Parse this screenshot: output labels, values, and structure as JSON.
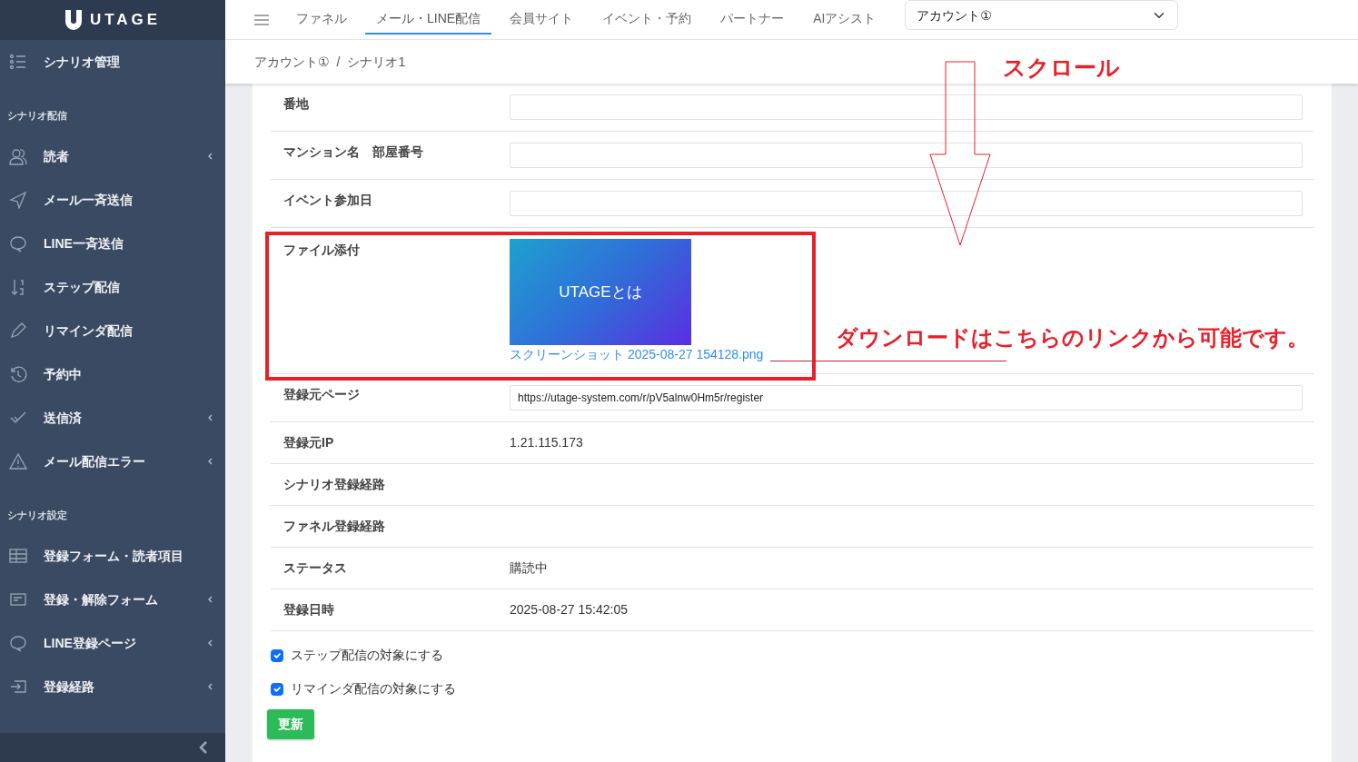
{
  "brand": {
    "name": "UTAGE"
  },
  "sidebar": {
    "items": [
      {
        "kind": "item",
        "label": "シナリオ管理",
        "submenu": false
      },
      {
        "kind": "heading",
        "label": "シナリオ配信"
      },
      {
        "kind": "item",
        "label": "読者",
        "submenu": true
      },
      {
        "kind": "item",
        "label": "メール一斉送信",
        "submenu": false
      },
      {
        "kind": "item",
        "label": "LINE一斉送信",
        "submenu": false
      },
      {
        "kind": "item",
        "label": "ステップ配信",
        "submenu": false
      },
      {
        "kind": "item",
        "label": "リマインダ配信",
        "submenu": false
      },
      {
        "kind": "item",
        "label": "予約中",
        "submenu": false
      },
      {
        "kind": "item",
        "label": "送信済",
        "submenu": true
      },
      {
        "kind": "item",
        "label": "メール配信エラー",
        "submenu": true
      },
      {
        "kind": "heading",
        "label": "シナリオ設定"
      },
      {
        "kind": "item",
        "label": "登録フォーム・読者項目",
        "submenu": false
      },
      {
        "kind": "item",
        "label": "登録・解除フォーム",
        "submenu": true
      },
      {
        "kind": "item",
        "label": "LINE登録ページ",
        "submenu": true
      },
      {
        "kind": "item",
        "label": "登録経路",
        "submenu": true
      }
    ]
  },
  "top_nav": {
    "tabs": [
      {
        "label": "ファネル",
        "selected": false
      },
      {
        "label": "メール・LINE配信",
        "selected": true
      },
      {
        "label": "会員サイト",
        "selected": false
      },
      {
        "label": "イベント・予約",
        "selected": false
      },
      {
        "label": "パートナー",
        "selected": false
      },
      {
        "label": "AIアシスト",
        "selected": false
      }
    ],
    "account_select": {
      "value": "アカウント①"
    }
  },
  "breadcrumb": {
    "items": [
      "アカウント①",
      "シナリオ1"
    ],
    "separator": "/"
  },
  "form": {
    "rows": [
      {
        "kind": "input",
        "label": "番地"
      },
      {
        "kind": "input",
        "label": "マンション名　部屋番号"
      },
      {
        "kind": "input",
        "label": "イベント参加日"
      },
      {
        "kind": "file",
        "label": "ファイル添付",
        "thumbnail_text": "UTAGEとは",
        "link": "スクリーンショット 2025-08-27 154128.png"
      },
      {
        "kind": "input",
        "label": "登録元ページ",
        "value": "https://utage-system.com/r/pV5alnw0Hm5r/register"
      },
      {
        "kind": "text",
        "label": "登録元IP",
        "value": "1.21.115.173"
      },
      {
        "kind": "text",
        "label": "シナリオ登録経路"
      },
      {
        "kind": "text",
        "label": "ファネル登録経路"
      },
      {
        "kind": "text",
        "label": "ステータス",
        "value": "購読中"
      },
      {
        "kind": "text",
        "label": "登録日時",
        "value": "2025-08-27 15:42:05"
      }
    ],
    "checkboxes": [
      {
        "label": "ステップ配信の対象にする",
        "checked": true
      },
      {
        "label": "リマインダ配信の対象にする",
        "checked": true
      }
    ],
    "submit": "更新"
  },
  "annotations": {
    "scroll_label": "スクロール",
    "note": "ダウンロードはこちらのリンクから可能です。"
  }
}
